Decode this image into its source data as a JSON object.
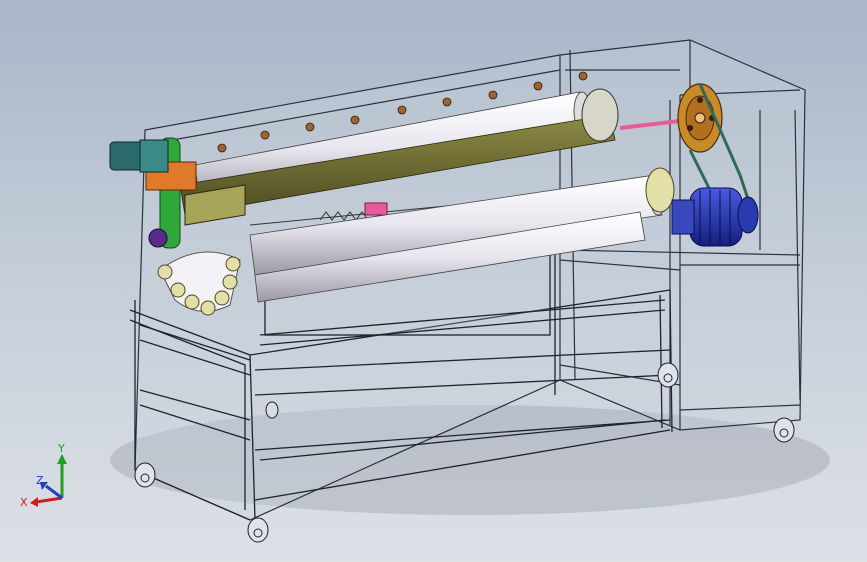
{
  "viewport": {
    "background_top": "#a8b6c8",
    "background_bottom": "#dde1e6"
  },
  "model": {
    "frame_color": "#1d2430",
    "roller_color": "#f2f1f4",
    "bar_color": "#6b6a2e",
    "motor_color": "#2233aa",
    "pulley_color": "#c98a2a",
    "gear_color": "#e2e0a8",
    "bracket_color": "#2ea83a",
    "accent_color": "#e85a9a"
  },
  "triad": {
    "x_label": "X",
    "y_label": "Y",
    "z_label": "Z",
    "x_color": "#c82020",
    "y_color": "#20a020",
    "z_color": "#2040c0"
  }
}
